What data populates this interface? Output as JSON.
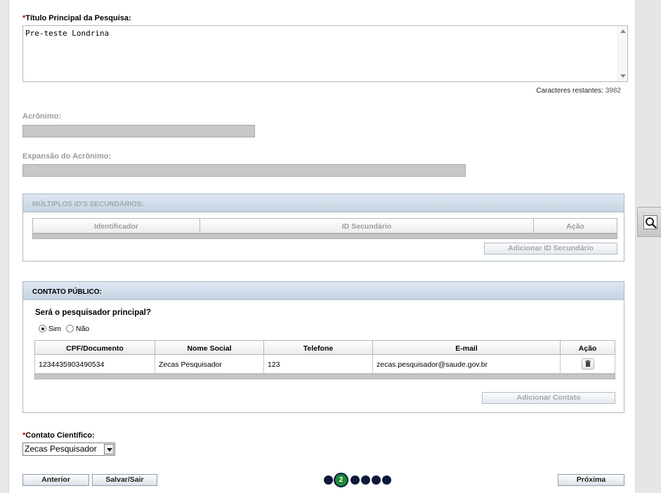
{
  "research_title": {
    "required_mark": "*",
    "label": "Título Principal da Pesquisa:",
    "value": "Pre-teste Londrina",
    "counter_label": "Caracteres restantes:",
    "counter_value": "3982"
  },
  "acronym": {
    "label": "Acrônimo:",
    "value": ""
  },
  "acronym_expansion": {
    "label": "Expansão do Acrônimo:",
    "value": ""
  },
  "secondary_ids": {
    "title": "MÚLTIPLOS ID'S SECUNDÁRIOS:",
    "columns": [
      "Identificador",
      "ID Secundário",
      "Ação"
    ],
    "add_button": "Adicionar ID Secundário"
  },
  "public_contact": {
    "title": "CONTATO PÚBLICO:",
    "question": "Será o pesquisador principal?",
    "options": [
      "Sim",
      "Não"
    ],
    "selected": "Sim",
    "columns": [
      "CPF/Documento",
      "Nome Social",
      "Telefone",
      "E-mail",
      "Ação"
    ],
    "rows": [
      {
        "document": "1234435903490534",
        "name": "Zecas Pesquisador",
        "phone": "123",
        "email": "zecas.pesquisador@saude.gov.br"
      }
    ],
    "add_button": "Adicionar Contato"
  },
  "scientific_contact": {
    "required_mark": "*",
    "label": "Contato Científico:",
    "selected": "Zecas Pesquisador"
  },
  "footer": {
    "prev_button": "Anterior",
    "save_button": "Salvar/Sair",
    "next_button": "Próxima",
    "steps_total": 6,
    "current_step": "2"
  },
  "colors": {
    "accent_green": "#1d8a3b",
    "step_dot": "#0c1a3a",
    "required": "#cc0000"
  },
  "icons": {
    "row_action": "trash-icon",
    "side_tool": "zoom-icon"
  }
}
